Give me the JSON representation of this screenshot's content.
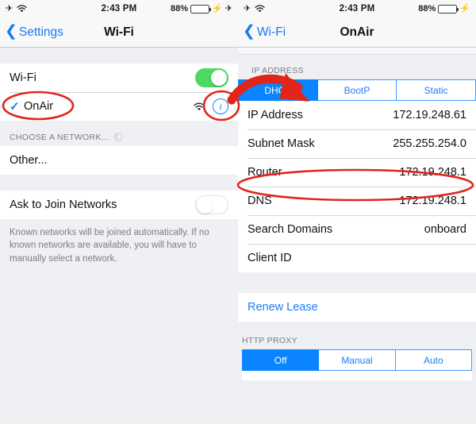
{
  "status_bar": {
    "airplane_icon": "airplane-icon",
    "wifi_icon": "wifi-icon",
    "time": "2:43 PM",
    "battery_percent": "88%",
    "charging_icon": "bolt-icon"
  },
  "left_panel": {
    "nav": {
      "back_label": "Settings",
      "title": "Wi-Fi"
    },
    "wifi_toggle_row": {
      "label": "Wi-Fi",
      "state": "on"
    },
    "network_row": {
      "name": "OnAir",
      "checked": true,
      "signal_icon": "wifi-signal-icon",
      "info_icon": "info-icon"
    },
    "choose_header": "CHOOSE A NETWORK...",
    "other_row": {
      "label": "Other..."
    },
    "ask_row": {
      "label": "Ask to Join Networks",
      "state": "off"
    },
    "footer_note": "Known networks will be joined automatically. If no known networks are available, you will have to manually select a network."
  },
  "right_panel": {
    "nav": {
      "back_label": "Wi-Fi",
      "title": "OnAir"
    },
    "ip_section_header": "IP ADDRESS",
    "ip_modes": [
      {
        "label": "DHCP",
        "selected": true
      },
      {
        "label": "BootP",
        "selected": false
      },
      {
        "label": "Static",
        "selected": false
      }
    ],
    "details": [
      {
        "label": "IP Address",
        "value": "172.19.248.61"
      },
      {
        "label": "Subnet Mask",
        "value": "255.255.254.0"
      },
      {
        "label": "Router",
        "value": "172.19.248.1"
      },
      {
        "label": "DNS",
        "value": "172.19.248.1"
      },
      {
        "label": "Search Domains",
        "value": "onboard"
      },
      {
        "label": "Client ID",
        "value": ""
      }
    ],
    "renew_lease_label": "Renew Lease",
    "proxy_section_header": "HTTP PROXY",
    "proxy_modes": [
      {
        "label": "Off",
        "selected": true
      },
      {
        "label": "Manual",
        "selected": false
      },
      {
        "label": "Auto",
        "selected": false
      }
    ]
  },
  "annotations": {
    "color": "#e1251b",
    "ellipse_network_name": "OnAir",
    "ellipse_info_button": "info-icon",
    "ellipse_router_row": "Router",
    "arrow_from": "info-icon",
    "arrow_to": "DHCP"
  }
}
